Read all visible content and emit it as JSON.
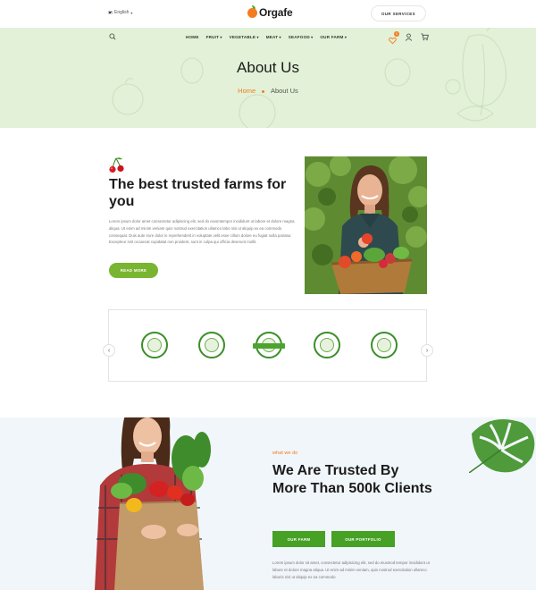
{
  "topbar": {
    "language": "English",
    "brand": "Orgafe",
    "services_button": "OUR SERVICES"
  },
  "nav": {
    "items": [
      {
        "label": "HOME"
      },
      {
        "label": "FRUIT"
      },
      {
        "label": "VEGETABLE"
      },
      {
        "label": "MEAT"
      },
      {
        "label": "SEAFOOD"
      },
      {
        "label": "OUR FARM"
      }
    ],
    "wishlist_count": "0"
  },
  "hero": {
    "title": "About Us",
    "breadcrumb": {
      "home": "Home",
      "current": "About Us"
    }
  },
  "about": {
    "title": "The best trusted farms for you",
    "body": "Lorem ipsum dolor amet consectetur adipiscing elit, sed do eiusmtempor incididunt ut labore et dolore magna aliqua. Ut enim ad minim veniam quis nostrud exercitation ullamco labo nisi ut aliquip ex ea commodo consequat. Duis aute irure dolor in reprehenderit in voluptate velit esse cillum dolore eu fugiat nulla pariatur. Excepteur sint occaecat cupidatat non proident, sunt in culpa qui officia deserunt mollit.",
    "button": "READ MORE"
  },
  "certificates": {
    "count": 5,
    "prev_icon": "chevron-left-icon",
    "next_icon": "chevron-right-icon"
  },
  "what_we_do": {
    "eyebrow": "what we do",
    "title": "We Are Trusted By More Than 500k Clients",
    "buttons": [
      "OUR FARM",
      "OUR PORTFOLIO"
    ],
    "body": "Lorem ipsum dolor sit amet, consectetur adipisicing elit, sed do eiusmod tempor incididunt ut labore et dolore magna aliqua. Ut enim ad minim veniam, quis nostrud exercitation ullamco laboris nisi ut aliquip ex ea commodo"
  },
  "colors": {
    "accent_orange": "#f47c20",
    "accent_green": "#79b530",
    "button_green": "#46a124",
    "hero_bg": "#e2f1d7",
    "section_bg": "#f1f6fa"
  }
}
